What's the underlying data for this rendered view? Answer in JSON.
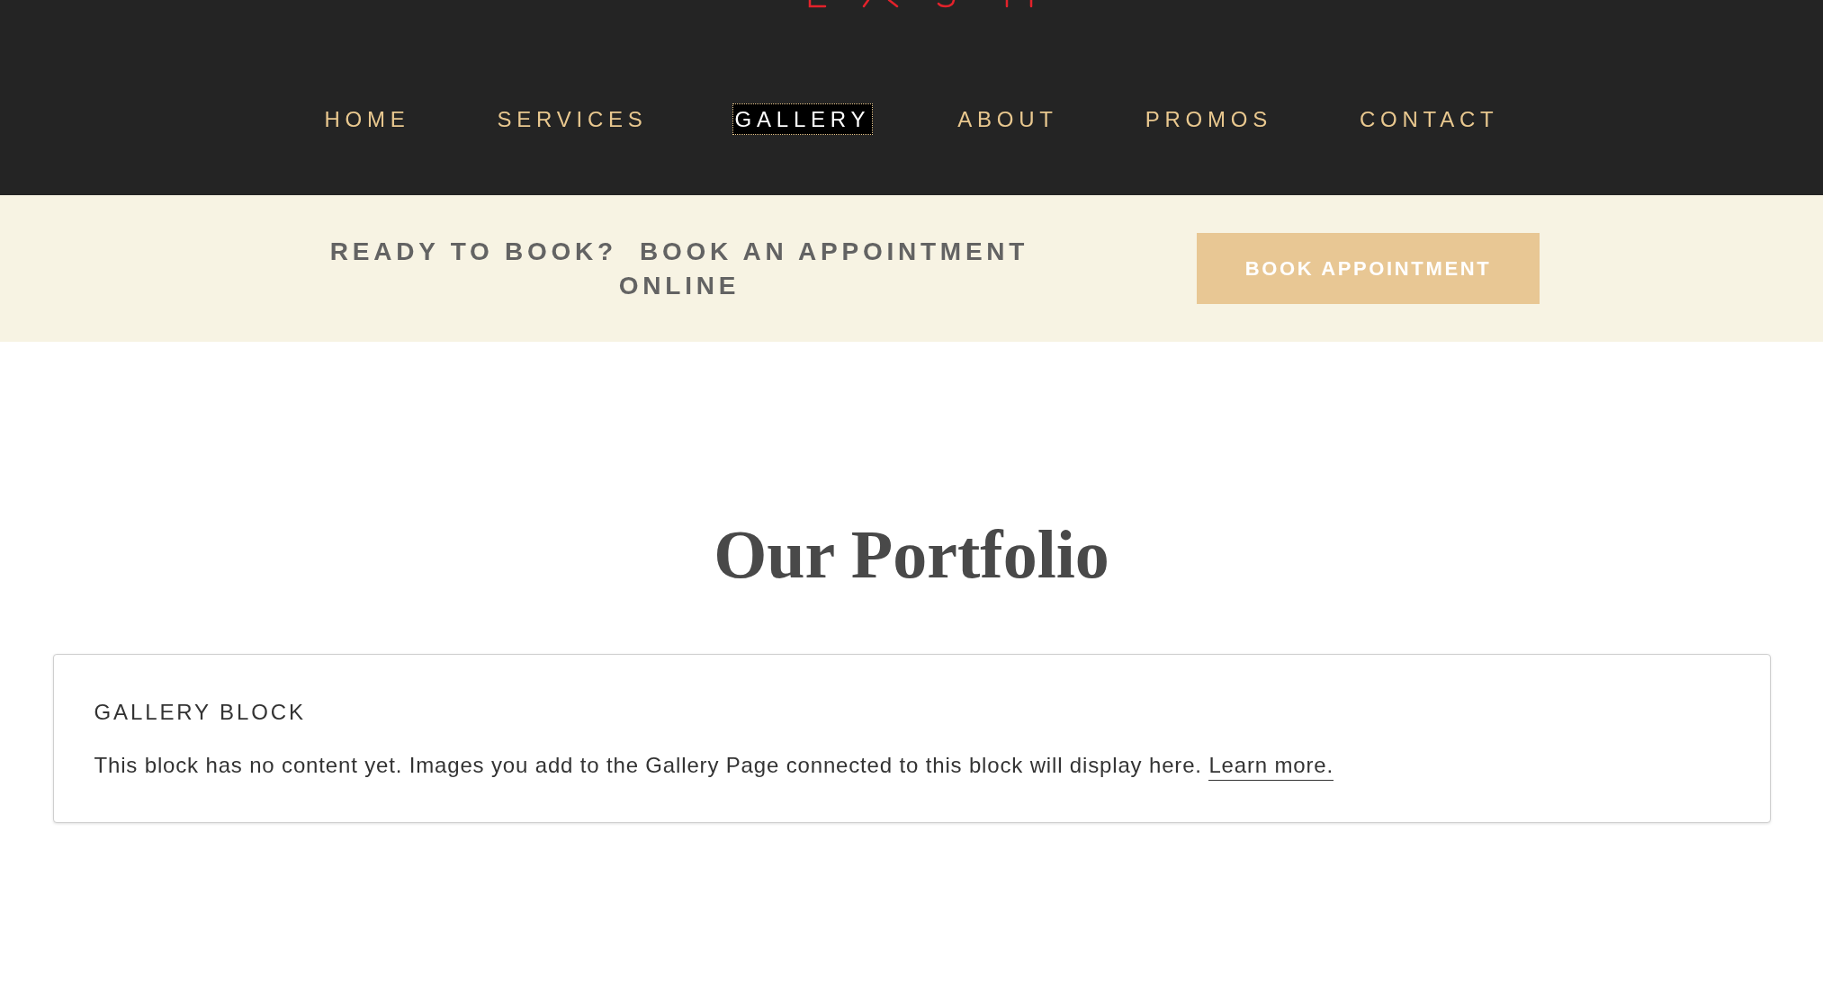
{
  "nav": [
    {
      "label": "HOME",
      "selected": false
    },
    {
      "label": "SERVICES",
      "selected": false
    },
    {
      "label": "GALLERY",
      "selected": true
    },
    {
      "label": "ABOUT",
      "selected": false
    },
    {
      "label": "PROMOS",
      "selected": false
    },
    {
      "label": "CONTACT",
      "selected": false
    }
  ],
  "booking_banner": {
    "prompt": "READY TO BOOK?  BOOK AN APPOINTMENT ONLINE",
    "button": "BOOK APPOINTMENT"
  },
  "heading": "Our Portfolio",
  "gallery_block": {
    "title": "GALLERY BLOCK",
    "message": "This block has no content yet. Images you add to the Gallery Page connected to this block will display here.",
    "link": "Learn more."
  }
}
